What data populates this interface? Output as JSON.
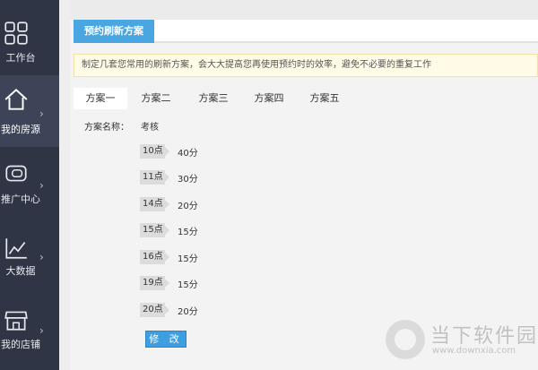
{
  "sidebar": {
    "items": [
      {
        "label": "工作台",
        "icon": "grid-icon",
        "active": false
      },
      {
        "label": "我的房源",
        "icon": "home-icon",
        "active": true
      },
      {
        "label": "推广中心",
        "icon": "promo-icon",
        "active": false
      },
      {
        "label": "大数据",
        "icon": "chart-icon",
        "active": false
      },
      {
        "label": "我的店铺",
        "icon": "shop-icon",
        "active": false
      }
    ],
    "chevron": "›"
  },
  "header": {
    "title": "预约刷新方案"
  },
  "notice": {
    "text": "制定几套您常用的刷新方案，会大大提高您再使用预约时的效率，避免不必要的重复工作"
  },
  "tabs": [
    {
      "label": "方案一",
      "active": true
    },
    {
      "label": "方案二",
      "active": false
    },
    {
      "label": "方案三",
      "active": false
    },
    {
      "label": "方案四",
      "active": false
    },
    {
      "label": "方案五",
      "active": false
    }
  ],
  "plan": {
    "name_label": "方案名称：",
    "name_value": "考核",
    "schedule": [
      {
        "hour": "10点",
        "minute": "40分"
      },
      {
        "hour": "11点",
        "minute": "30分"
      },
      {
        "hour": "14点",
        "minute": "20分"
      },
      {
        "hour": "15点",
        "minute": "15分"
      },
      {
        "hour": "16点",
        "minute": "15分"
      },
      {
        "hour": "19点",
        "minute": "15分"
      },
      {
        "hour": "20点",
        "minute": "20分"
      }
    ]
  },
  "modify_button": "修 改",
  "watermark": {
    "cn": "当下软件园",
    "url": "www.downxia.com"
  },
  "colors": {
    "sidebar": "#2f3545",
    "accent": "#4aa6e0",
    "button": "#3d9fe0"
  }
}
